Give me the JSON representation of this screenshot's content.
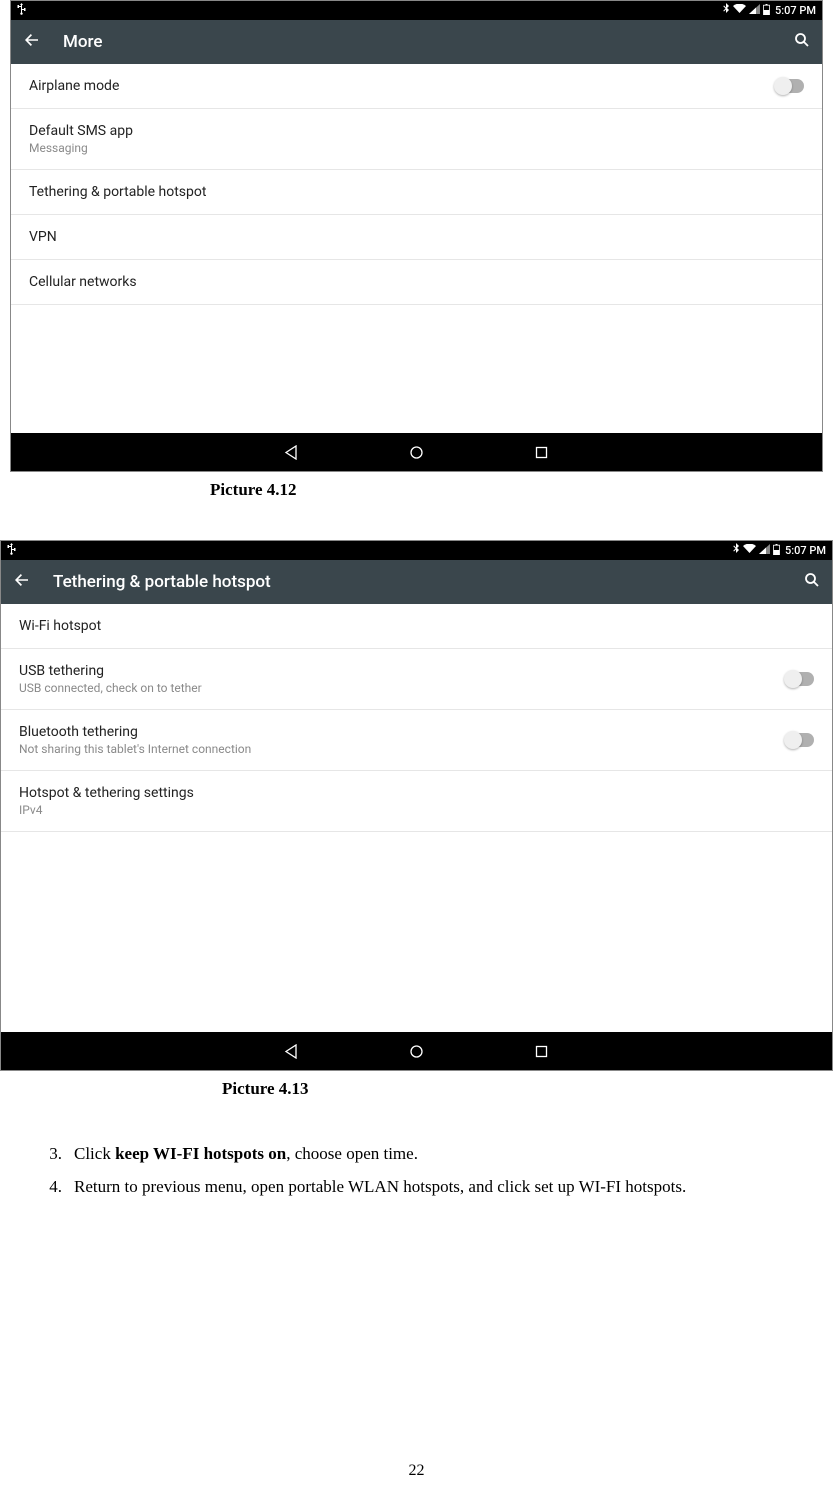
{
  "screen1": {
    "status": {
      "time": "5:07 PM"
    },
    "appbar": {
      "title": "More"
    },
    "items": [
      {
        "primary": "Airplane mode",
        "toggle": true
      },
      {
        "primary": "Default SMS app",
        "secondary": "Messaging"
      },
      {
        "primary": "Tethering & portable hotspot"
      },
      {
        "primary": "VPN"
      },
      {
        "primary": "Cellular networks"
      }
    ],
    "caption": "Picture 4.12"
  },
  "screen2": {
    "status": {
      "time": "5:07 PM"
    },
    "appbar": {
      "title": "Tethering & portable hotspot"
    },
    "items": [
      {
        "primary": "Wi-Fi hotspot"
      },
      {
        "primary": "USB tethering",
        "secondary": "USB connected, check on to tether",
        "toggle": true
      },
      {
        "primary": "Bluetooth tethering",
        "secondary": "Not sharing this tablet's Internet connection",
        "toggle": true
      },
      {
        "primary": "Hotspot & tethering settings",
        "secondary": "IPv4"
      }
    ],
    "caption": "Picture 4.13"
  },
  "instructions": {
    "item3": {
      "num": "3.",
      "pre": "Click ",
      "bold": "keep WI-FI hotspots on",
      "post": ", choose open time."
    },
    "item4": {
      "num": "4.",
      "text": "Return to previous menu, open portable WLAN hotspots, and click set up WI-FI hotspots."
    }
  },
  "pageNumber": "22"
}
